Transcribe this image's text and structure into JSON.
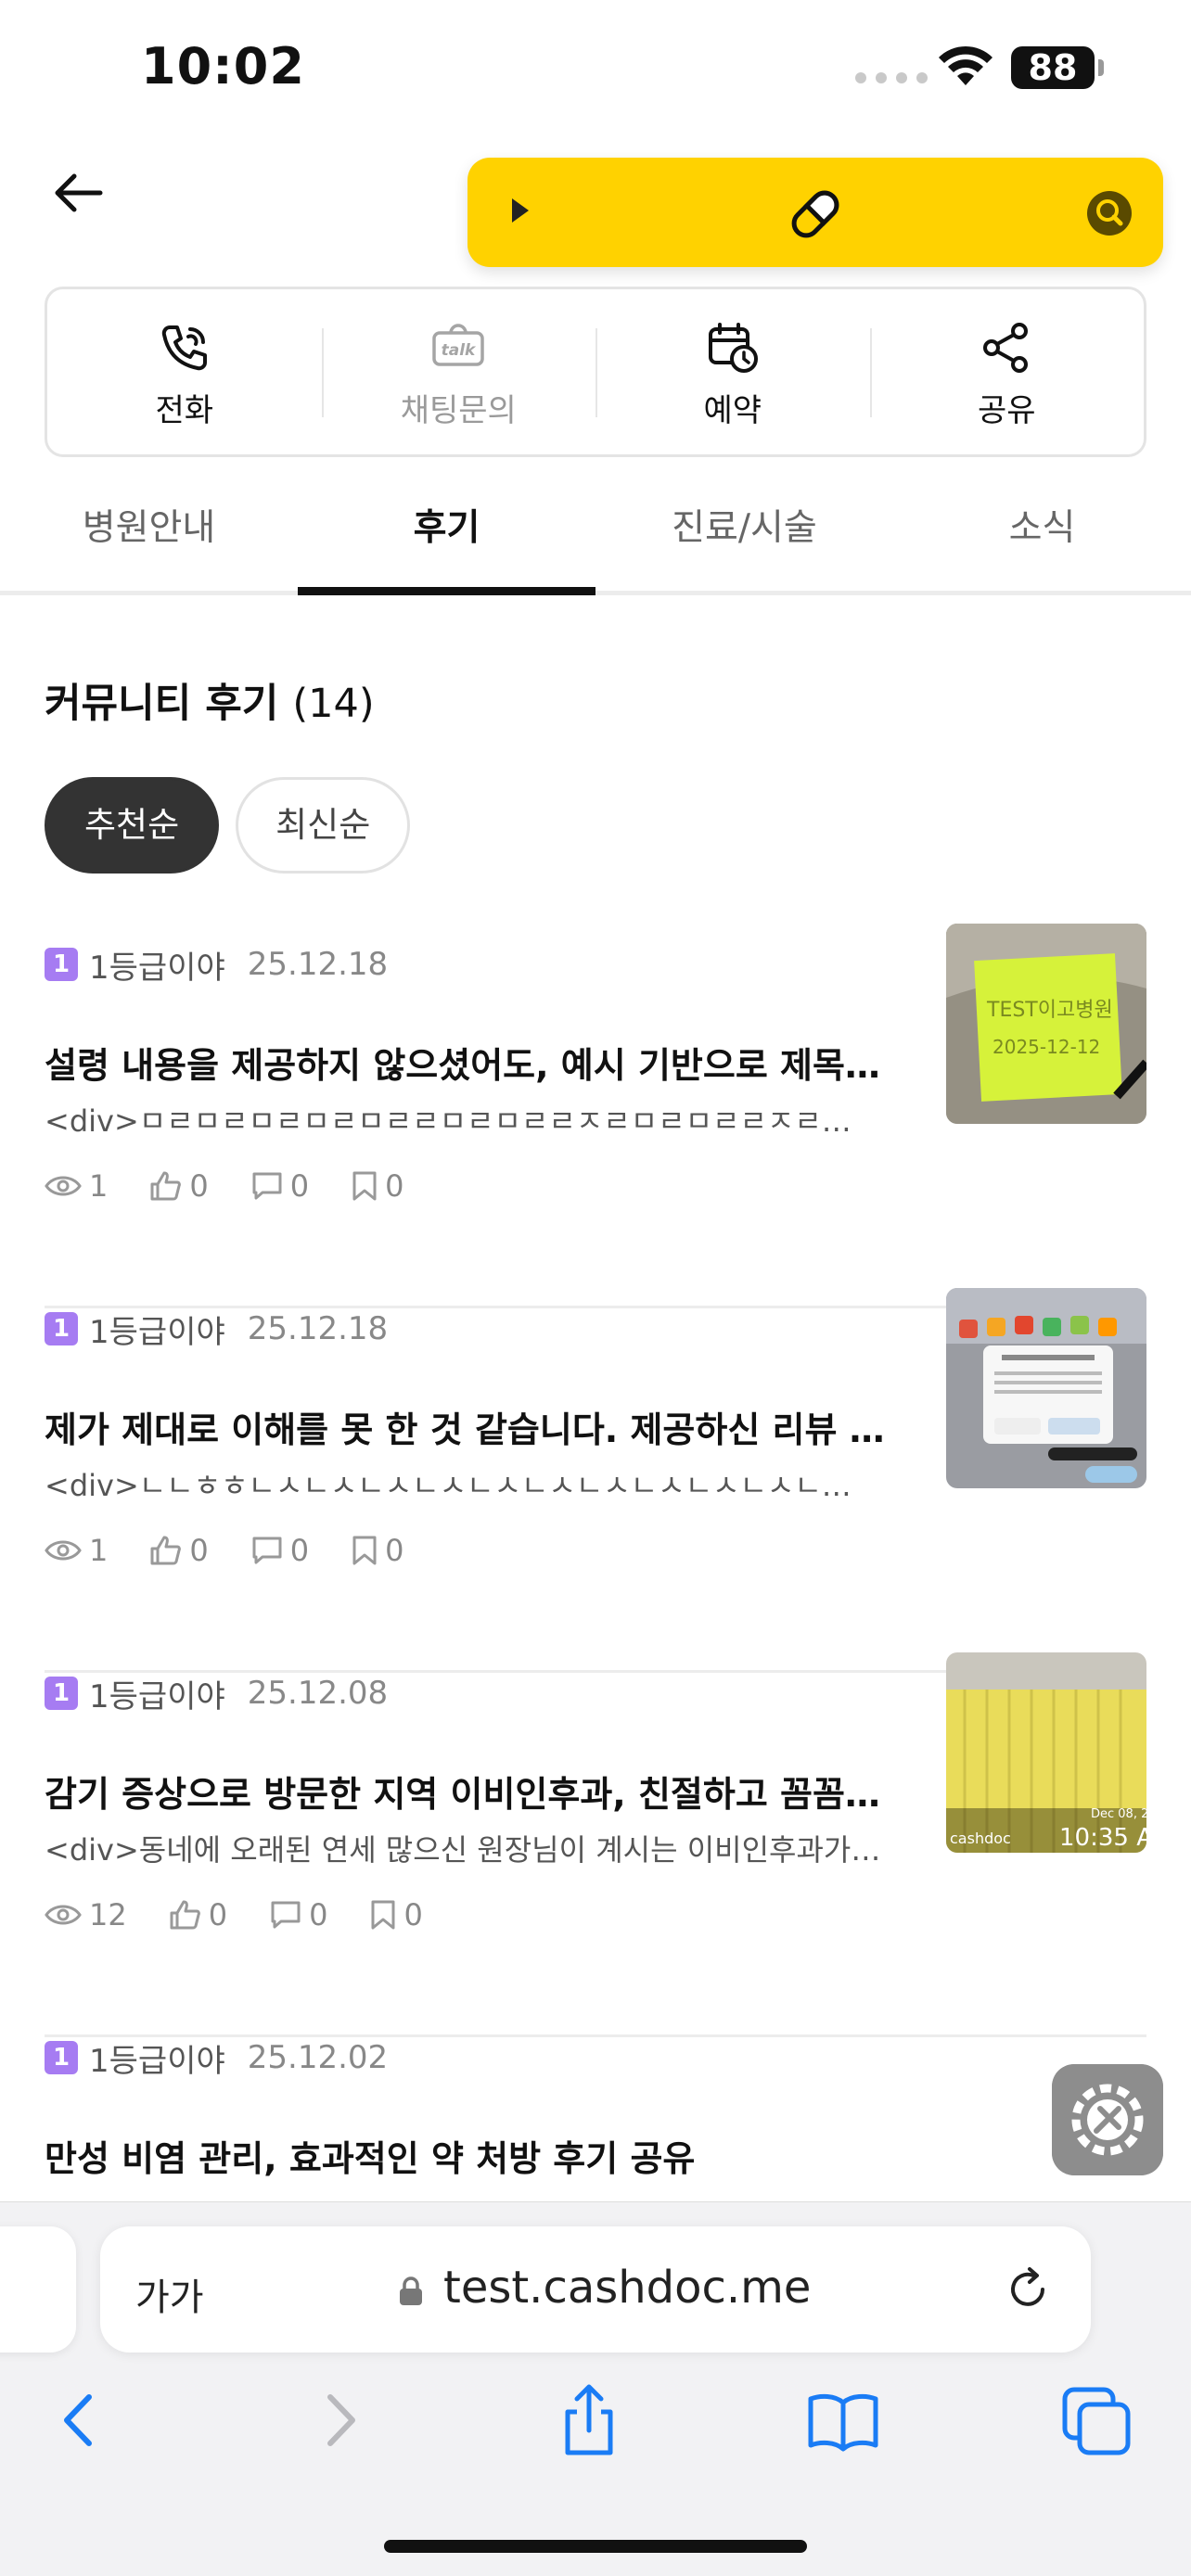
{
  "status_bar": {
    "time": "10:02",
    "battery": "88"
  },
  "actions": [
    {
      "label": "전화",
      "icon": "phone-icon",
      "enabled": true
    },
    {
      "label": "채팅문의",
      "icon": "talk-icon",
      "enabled": false
    },
    {
      "label": "예약",
      "icon": "calendar-clock-icon",
      "enabled": true
    },
    {
      "label": "공유",
      "icon": "share-icon",
      "enabled": true
    }
  ],
  "tabs": [
    {
      "label": "병원안내",
      "active": false
    },
    {
      "label": "후기",
      "active": true
    },
    {
      "label": "진료/시술",
      "active": false
    },
    {
      "label": "소식",
      "active": false
    }
  ],
  "section": {
    "title": "커뮤니티 후기",
    "count": "(14)"
  },
  "sort": [
    {
      "label": "추천순",
      "active": true
    },
    {
      "label": "최신순",
      "active": false
    }
  ],
  "reviews": [
    {
      "grade": "1",
      "author": "1등급이야",
      "date": "25.12.18",
      "title": "설령 내용을 제공하지 않으셨어도, 예시 기반으로 제목…",
      "body": "<div>ㅁㄹㅁㄹㅁㄹㅁㄹㅁㄹㄹㅁㄹㅁㄹㄹㅈㄹㅁㄹㅁㄹㄹㅈㄹ…",
      "views": "1",
      "likes": "0",
      "comments": "0",
      "bookmarks": "0",
      "thumb": "sticky-note-photo"
    },
    {
      "grade": "1",
      "author": "1등급이야",
      "date": "25.12.18",
      "title": "제가 제대로 이해를 못 한 것 같습니다. 제공하신 리뷰 …",
      "body": "<div>ㄴㄴㅎㅎㄴㅅㄴㅅㄴㅅㄴㅅㄴㅅㄴㅅㄴㅅㄴㅅㄴㅅㄴㅅㄴ…",
      "views": "1",
      "likes": "0",
      "comments": "0",
      "bookmarks": "0",
      "thumb": "app-screenshot"
    },
    {
      "grade": "1",
      "author": "1등급이야",
      "date": "25.12.08",
      "title": "감기 증상으로 방문한 지역 이비인후과, 친절하고 꼼꼼…",
      "body": "<div>동네에 오래된 연세 많으신 원장님이 계시는 이비인후과가…",
      "views": "12",
      "likes": "0",
      "comments": "0",
      "bookmarks": "0",
      "thumb": "yellow-wall-photo",
      "thumb_caption": {
        "brand": "cashdoc",
        "date": "Dec 08, 2",
        "time": "10:35 A"
      }
    },
    {
      "grade": "1",
      "author": "1등급이야",
      "date": "25.12.02",
      "title": "만성 비염 관리, 효과적인 약 처방 후기 공유"
    }
  ],
  "browser": {
    "aa": "가가",
    "url": "test.cashdoc.me"
  },
  "colors": {
    "accent_yellow": "#ffd200",
    "grade_purple": "#a67cf2",
    "active_chip": "#333333"
  }
}
